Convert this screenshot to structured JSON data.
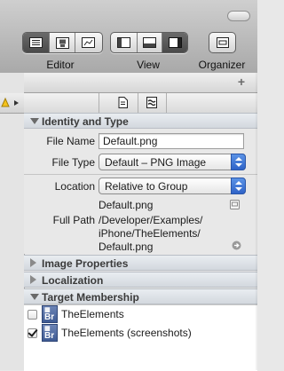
{
  "toolbar": {
    "editor_label": "Editor",
    "view_label": "View",
    "organizer_label": "Organizer",
    "editor_selected": "standard",
    "view_selected": "utilities"
  },
  "inspector": {
    "add_symbol": "+",
    "tabs": [
      {
        "icon": "file-inspector-icon",
        "selected": true
      },
      {
        "icon": "quick-help-icon",
        "selected": false
      }
    ],
    "identity": {
      "header": "Identity and Type",
      "file_name_label": "File Name",
      "file_name_value": "Default.png",
      "file_type_label": "File Type",
      "file_type_value": "Default – PNG Image",
      "location_label": "Location",
      "location_value": "Relative to Group",
      "location_file": "Default.png",
      "full_path_label": "Full Path",
      "full_path_lines": [
        "/Developer/Examples/",
        "iPhone/TheElements/",
        "Default.png"
      ]
    },
    "image_properties": {
      "header": "Image Properties"
    },
    "localization": {
      "header": "Localization"
    },
    "target_membership": {
      "header": "Target Membership",
      "targets": [
        {
          "name": "TheElements",
          "checked": false
        },
        {
          "name": "TheElements (screenshots)",
          "checked": true
        }
      ]
    }
  }
}
